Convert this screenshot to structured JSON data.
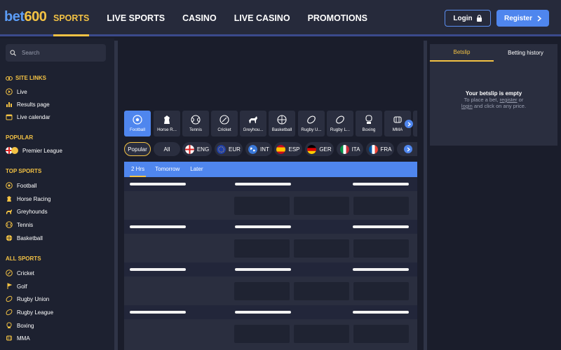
{
  "header": {
    "logo_prefix": "bet",
    "logo_num": "600",
    "nav": [
      "SPORTS",
      "LIVE SPORTS",
      "CASINO",
      "LIVE CASINO",
      "PROMOTIONS"
    ],
    "login_label": "Login",
    "register_label": "Register"
  },
  "sidebar": {
    "search_placeholder": "Search",
    "site_links_title": "SITE LINKS",
    "site_links": [
      "Live",
      "Results page",
      "Live calendar"
    ],
    "popular_title": "POPULAR",
    "popular": [
      "Premier League"
    ],
    "top_sports_title": "TOP SPORTS",
    "top_sports": [
      "Football",
      "Horse Racing",
      "Greyhounds",
      "Tennis",
      "Basketball"
    ],
    "all_sports_title": "ALL SPORTS",
    "all_sports": [
      "Cricket",
      "Golf",
      "Rugby Union",
      "Rugby League",
      "Boxing",
      "MMA"
    ]
  },
  "sports_bar": [
    "Football",
    "Horse R...",
    "Tennis",
    "Cricket",
    "Greyhou...",
    "Basketball",
    "Rugby U...",
    "Rugby L...",
    "Boxing",
    "MMA"
  ],
  "chips": [
    "Popular",
    "All",
    "ENG",
    "EUR",
    "INT",
    "ESP",
    "GER",
    "ITA",
    "FRA"
  ],
  "tabs": [
    "2 Hrs",
    "Tomorrow",
    "Later"
  ],
  "betslip": {
    "tab_betslip": "Betslip",
    "tab_history": "Betting history",
    "empty_title": "Your betslip is empty",
    "line1_prefix": "To place a bet,",
    "register_link": "register",
    "line1_suffix": "or",
    "login_link": "login",
    "line2_suffix": "and click on any price."
  },
  "colors": {
    "accent": "#f3c244",
    "primary": "#4f86ee",
    "bg": "#1a1d2b"
  }
}
